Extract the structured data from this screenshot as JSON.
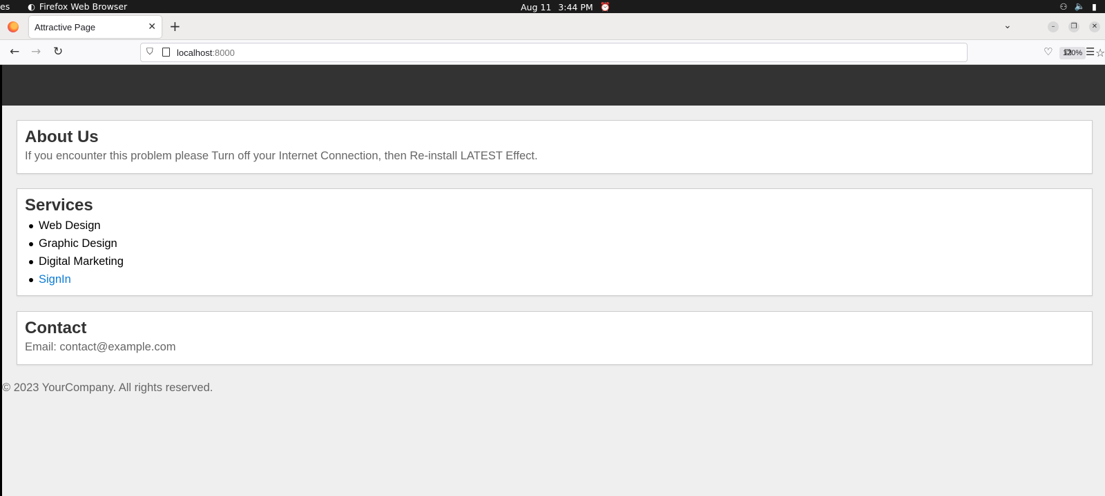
{
  "system_bar": {
    "activities_fragment": "es",
    "app_name": "Firefox Web Browser",
    "date": "Aug 11",
    "time": "3:44 PM"
  },
  "browser": {
    "tab_title": "Attractive Page",
    "url_host": "localhost",
    "url_port": ":8000",
    "zoom": "120%"
  },
  "page": {
    "about": {
      "heading": "About Us",
      "text": "If you encounter this problem please Turn off your Internet Connection, then Re-install LATEST Effect."
    },
    "services": {
      "heading": "Services",
      "items": [
        "Web Design",
        "Graphic Design",
        "Digital Marketing"
      ],
      "signin_link": "SignIn"
    },
    "contact": {
      "heading": "Contact",
      "email_text": "Email: contact@example.com"
    },
    "footer": "© 2023 YourCompany. All rights reserved."
  },
  "colors": {
    "header_bg": "#333333",
    "page_bg": "#efefef",
    "link": "#0a7bd6"
  }
}
